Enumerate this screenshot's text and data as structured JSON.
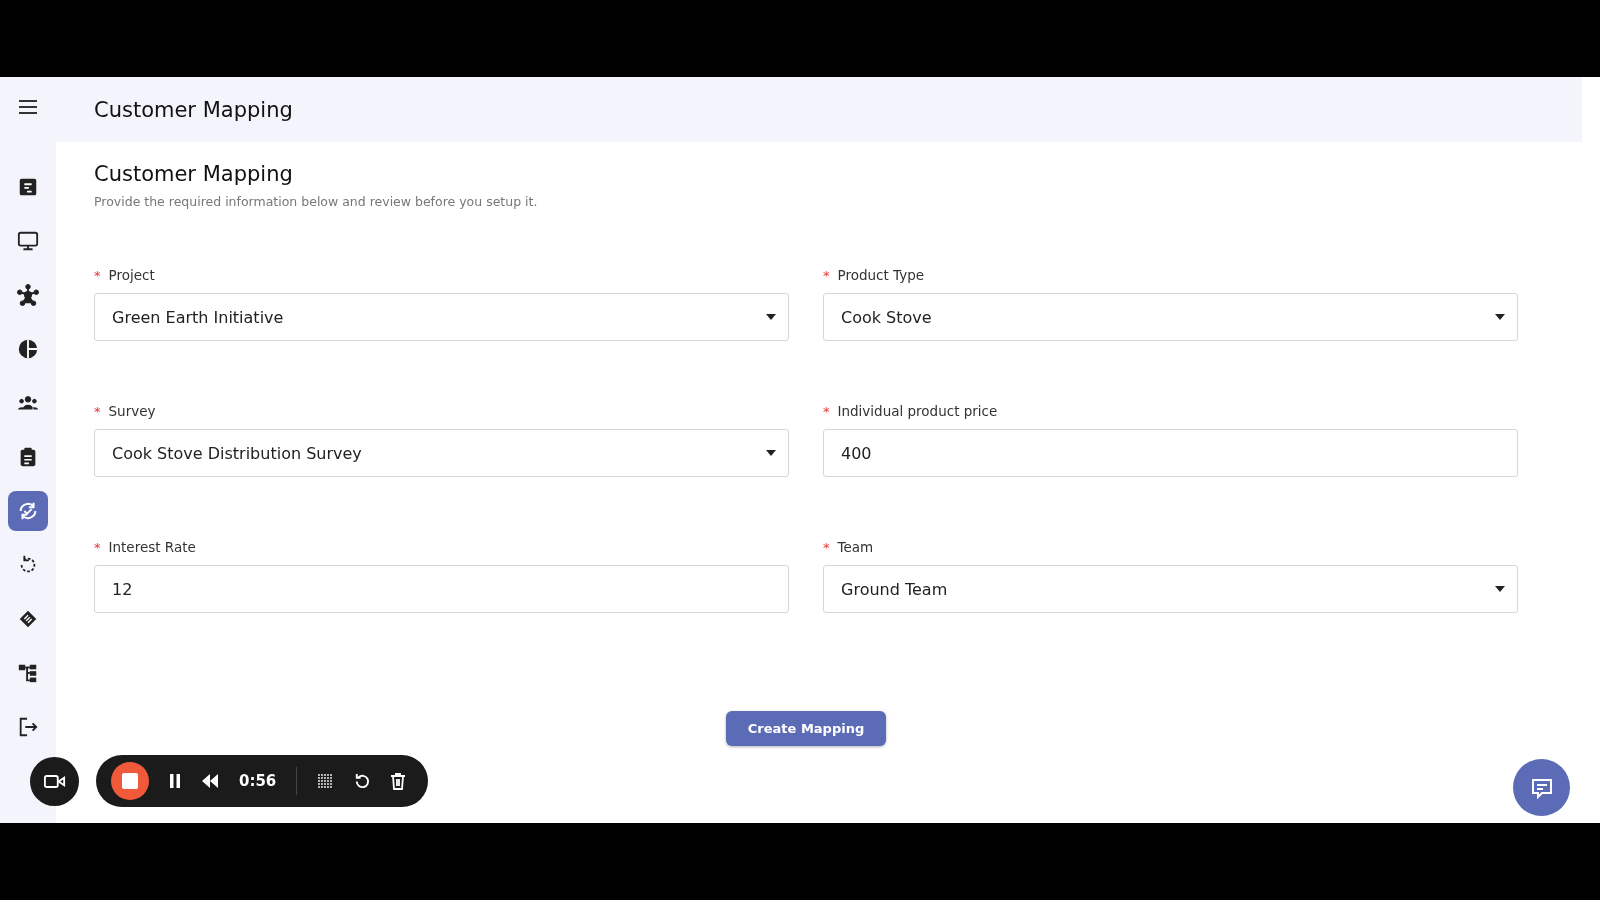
{
  "header": {
    "title": "Customer Mapping"
  },
  "sidebar": {
    "items": [
      {
        "kind": "list",
        "selected": false
      },
      {
        "kind": "monitor",
        "selected": false
      },
      {
        "kind": "network",
        "selected": false
      },
      {
        "kind": "pie",
        "selected": false
      },
      {
        "kind": "people",
        "selected": false
      },
      {
        "kind": "clipboard",
        "selected": false
      },
      {
        "kind": "sync",
        "selected": true
      },
      {
        "kind": "refresh",
        "selected": false
      },
      {
        "kind": "handshake",
        "selected": false
      },
      {
        "kind": "hierarchy",
        "selected": false
      },
      {
        "kind": "logout",
        "selected": false
      }
    ]
  },
  "form": {
    "title": "Customer Mapping",
    "subtitle": "Provide the required information below and review before you setup it.",
    "fields": [
      {
        "label": "Project",
        "kind": "select",
        "value": "Green Earth Initiative",
        "required_mark": "*"
      },
      {
        "label": "Product Type",
        "kind": "select",
        "value": "Cook Stove",
        "required_mark": "*"
      },
      {
        "label": "Survey",
        "kind": "select",
        "value": "Cook Stove Distribution Survey",
        "required_mark": "*"
      },
      {
        "label": "Individual product price",
        "kind": "text",
        "value": "400",
        "required_mark": "*"
      },
      {
        "label": "Interest Rate",
        "kind": "text",
        "value": "12",
        "required_mark": "*"
      },
      {
        "label": "Team",
        "kind": "select",
        "value": "Ground Team",
        "required_mark": "*"
      }
    ],
    "submit": "Create Mapping"
  },
  "recorder": {
    "time": "0:56"
  }
}
